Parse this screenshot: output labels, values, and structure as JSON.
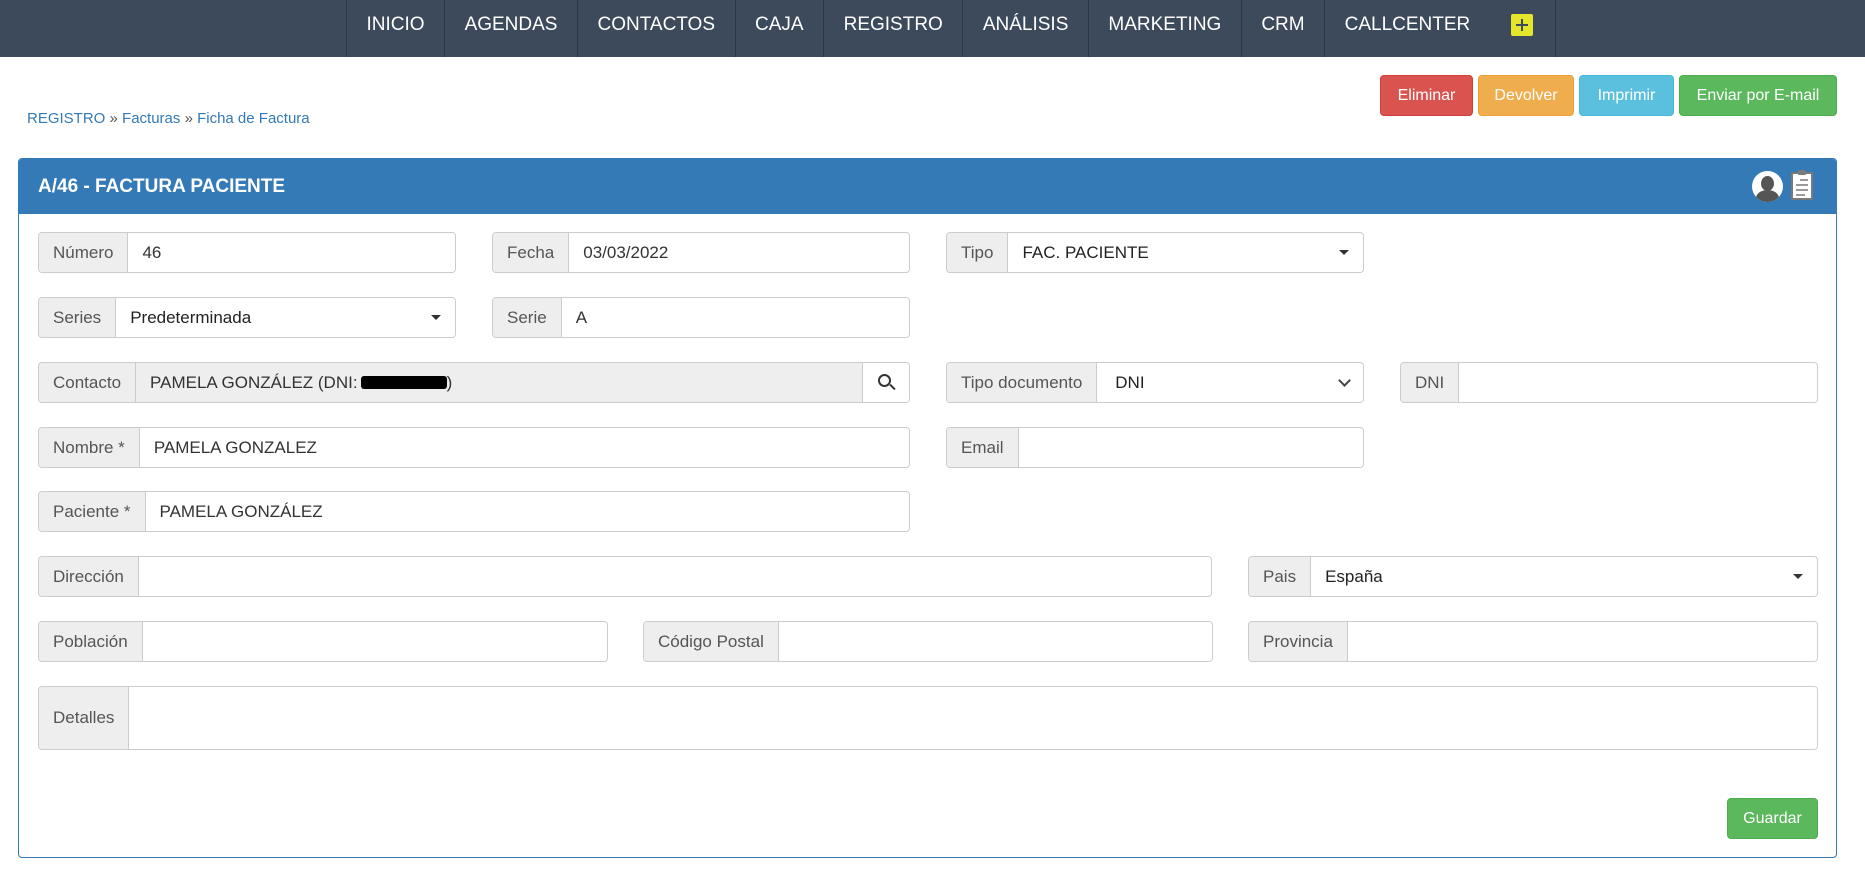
{
  "nav": {
    "items": [
      "INICIO",
      "AGENDAS",
      "CONTACTOS",
      "CAJA",
      "REGISTRO",
      "ANÁLISIS",
      "MARKETING",
      "CRM",
      "CALLCENTER"
    ]
  },
  "breadcrumb": {
    "level1": "REGISTRO",
    "level2": "Facturas",
    "level3": "Ficha de Factura",
    "separator": "»"
  },
  "actions": {
    "delete": "Eliminar",
    "return": "Devolver",
    "print": "Imprimir",
    "email": "Enviar por E-mail"
  },
  "panel": {
    "title": "A/46 - FACTURA PACIENTE"
  },
  "form": {
    "numero": {
      "label": "Número",
      "value": "46"
    },
    "fecha": {
      "label": "Fecha",
      "value": "03/03/2022"
    },
    "tipo": {
      "label": "Tipo",
      "value": "FAC. PACIENTE"
    },
    "series": {
      "label": "Series",
      "value": "Predeterminada"
    },
    "serie": {
      "label": "Serie",
      "value": "A"
    },
    "contacto": {
      "label": "Contacto",
      "value_prefix": "PAMELA GONZÁLEZ (DNI:",
      "value_suffix": ")"
    },
    "tipo_documento": {
      "label": "Tipo documento",
      "value": "DNI"
    },
    "dni": {
      "label": "DNI",
      "value": ""
    },
    "nombre": {
      "label": "Nombre *",
      "value": "PAMELA GONZALEZ"
    },
    "email": {
      "label": "Email",
      "value": ""
    },
    "paciente": {
      "label": "Paciente *",
      "value": "PAMELA GONZÁLEZ"
    },
    "direccion": {
      "label": "Dirección",
      "value": ""
    },
    "pais": {
      "label": "Pais",
      "value": "España"
    },
    "poblacion": {
      "label": "Población",
      "value": ""
    },
    "codigo_postal": {
      "label": "Código Postal",
      "value": ""
    },
    "provincia": {
      "label": "Provincia",
      "value": ""
    },
    "detalles": {
      "label": "Detalles",
      "value": ""
    }
  },
  "save": {
    "label": "Guardar"
  },
  "colors": {
    "nav_bg": "#3c4a5c",
    "panel_header": "#337ab7",
    "danger": "#d9534f",
    "warning": "#f0ad4e",
    "info": "#5bc0de",
    "success": "#5cb85c",
    "plus_icon": "#e5e52b"
  }
}
